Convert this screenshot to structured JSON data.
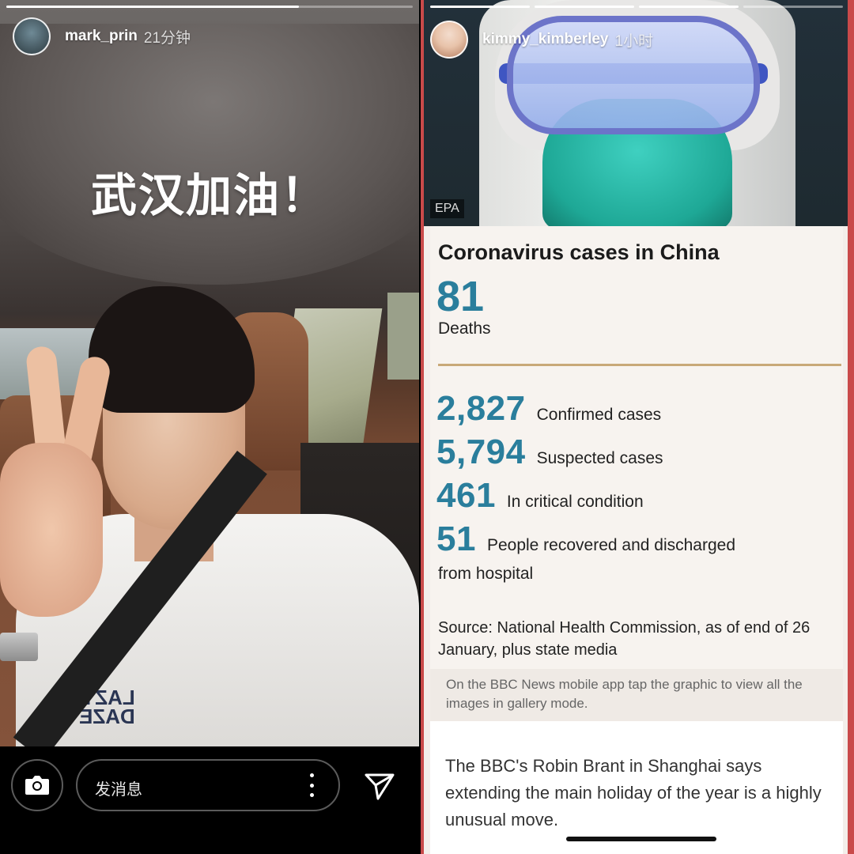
{
  "left_story": {
    "username": "mark_prin",
    "time": "21分钟",
    "caption": "武汉加油！",
    "shirt_print": "LAZY DAZE",
    "progress": 0.72,
    "message_placeholder": "发消息",
    "icons": {
      "camera": "camera-icon",
      "more": "more-vertical-icon",
      "send": "paper-plane-icon"
    }
  },
  "right_story": {
    "username": "kimmy_kimberley",
    "time": "1小时",
    "progress_segments": [
      1,
      1,
      1,
      0
    ],
    "photo_credit": "EPA",
    "card": {
      "title": "Coronavirus cases in China",
      "deaths_value": "81",
      "deaths_label": "Deaths",
      "stats": [
        {
          "value": "2,827",
          "label": "Confirmed cases"
        },
        {
          "value": "5,794",
          "label": "Suspected cases"
        },
        {
          "value": "461",
          "label": "In critical condition"
        },
        {
          "value": "51",
          "label": "People recovered and discharged"
        }
      ],
      "recovered_cont": "from hospital",
      "source": "Source: National Health Commission, as of end of 26 January, plus state media"
    },
    "app_tip": "On the BBC News mobile app tap the graphic to view all the images in gallery mode.",
    "caption": "The BBC's Robin Brant in Shanghai says extending the main holiday of the year is a highly unusual move."
  },
  "colors": {
    "accent_blue": "#2a7e9c",
    "divider_gold": "#c8a878",
    "story_border": "#c94a4a"
  }
}
